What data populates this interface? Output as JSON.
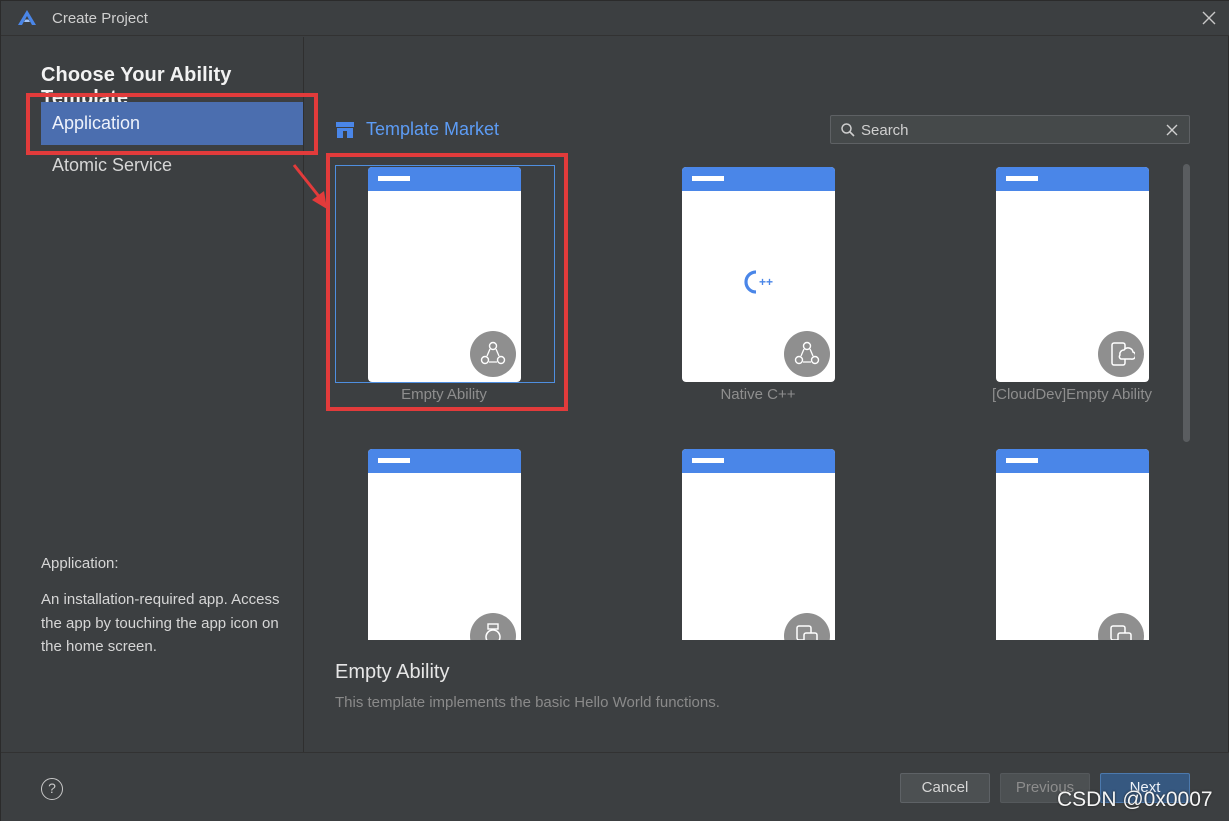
{
  "window": {
    "title": "Create Project"
  },
  "left": {
    "heading": "Choose Your Ability Template",
    "nav": [
      {
        "label": "Application",
        "selected": true
      },
      {
        "label": "Atomic Service",
        "selected": false
      }
    ],
    "description_title": "Application:",
    "description_body": "An installation-required app. Access the app by touching the app icon on the home screen."
  },
  "market": {
    "label": "Template Market"
  },
  "search": {
    "value": "",
    "placeholder": "Search"
  },
  "templates": [
    {
      "label": "Empty Ability",
      "icon": "ability-icon",
      "selected": true
    },
    {
      "label": "Native C++",
      "icon": "ability-icon",
      "selected": false
    },
    {
      "label": "[CloudDev]Empty Ability",
      "icon": "cloud-phone-icon",
      "selected": false
    },
    {
      "label": "",
      "icon": "watch-icon",
      "selected": false
    },
    {
      "label": "",
      "icon": "widget-icon",
      "selected": false
    },
    {
      "label": "",
      "icon": "widget-icon",
      "selected": false
    }
  ],
  "cpp_mark": "C++",
  "detail": {
    "title": "Empty Ability",
    "description": "This template implements the basic Hello World functions."
  },
  "footer": {
    "help": "?",
    "cancel": "Cancel",
    "previous": "Previous",
    "next": "Next"
  },
  "watermark": "CSDN @0x0007",
  "colors": {
    "accent": "#4b6eaf",
    "link": "#5d9cf5",
    "highlight_red": "#e23b3b",
    "phone_bar": "#4a86e8"
  }
}
